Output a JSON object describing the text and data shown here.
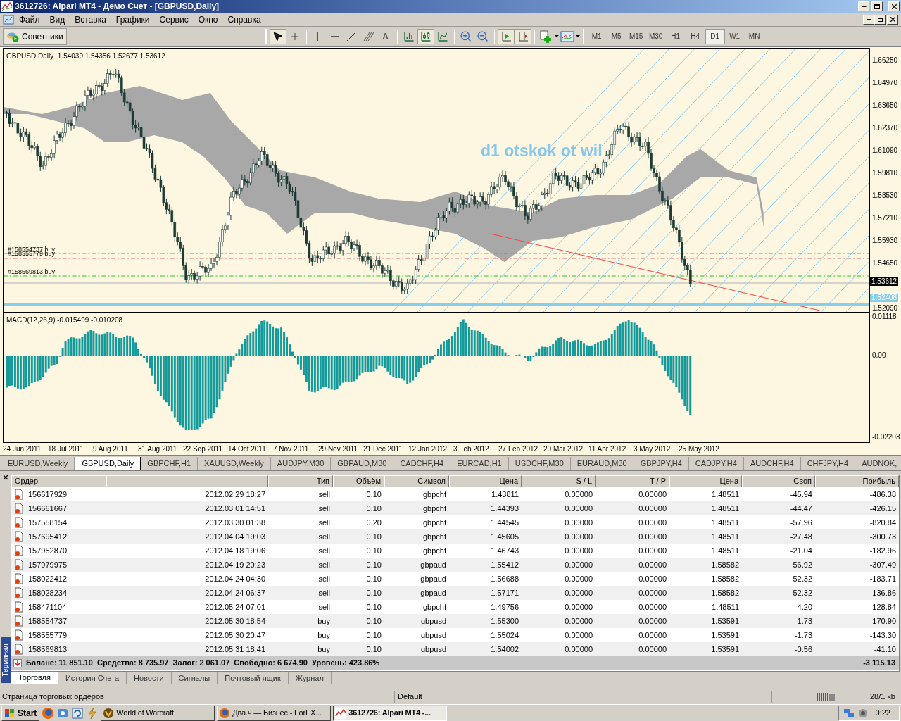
{
  "window": {
    "title": "3612726: Alpari MT4 - Демо Счет - [GBPUSD,Daily]"
  },
  "menu": [
    "Файл",
    "Вид",
    "Вставка",
    "Графики",
    "Сервис",
    "Окно",
    "Справка"
  ],
  "toolbar": {
    "advisors": "Советники",
    "text_tool": "A",
    "timeframes": [
      {
        "label": "M1",
        "selected": false
      },
      {
        "label": "M5",
        "selected": false
      },
      {
        "label": "M15",
        "selected": false
      },
      {
        "label": "M30",
        "selected": false
      },
      {
        "label": "H1",
        "selected": false
      },
      {
        "label": "H4",
        "selected": false
      },
      {
        "label": "D1",
        "selected": true
      },
      {
        "label": "W1",
        "selected": false
      },
      {
        "label": "MN",
        "selected": false
      }
    ]
  },
  "chart": {
    "header": "GBPUSD,Daily  1.54039 1.54356 1.52677 1.53612",
    "note": "d1 otskok ot wil",
    "order_labels": [
      "#158554737 buy",
      "#158555779 buy",
      "#158569813 buy"
    ],
    "price_ticks": [
      "1.66250",
      "1.64970",
      "1.63650",
      "1.62370",
      "1.61090",
      "1.59810",
      "1.58530",
      "1.57210",
      "1.55930",
      "1.54650",
      "1.52090"
    ],
    "current_price": "1.53612",
    "line_price": "1.52408",
    "macd": {
      "header": "MACD(12,26,9) -0.015499 -0.010208",
      "ticks": [
        "0.01118",
        "0.00",
        "-0.02203"
      ]
    },
    "dates": [
      "24 Jun 2011",
      "18 Jul 2011",
      "9 Aug 2011",
      "31 Aug 2011",
      "22 Sep 2011",
      "14 Oct 2011",
      "7 Nov 2011",
      "29 Nov 2011",
      "21 Dec 2011",
      "12 Jan 2012",
      "3 Feb 2012",
      "27 Feb 2012",
      "20 Mar 2012",
      "11 Apr 2012",
      "3 May 2012",
      "25 May 2012"
    ]
  },
  "chart_tabs": [
    {
      "label": "EURUSD,Weekly",
      "selected": false
    },
    {
      "label": "GBPUSD,Daily",
      "selected": true
    },
    {
      "label": "GBPCHF,H1",
      "selected": false
    },
    {
      "label": "XAUUSD,Weekly",
      "selected": false
    },
    {
      "label": "AUDJPY,M30",
      "selected": false
    },
    {
      "label": "GBPAUD,M30",
      "selected": false
    },
    {
      "label": "CADCHF,H4",
      "selected": false
    },
    {
      "label": "EURCAD,H1",
      "selected": false
    },
    {
      "label": "USDCHF,M30",
      "selected": false
    },
    {
      "label": "EURAUD,M30",
      "selected": false
    },
    {
      "label": "GBPJPY,H4",
      "selected": false
    },
    {
      "label": "CADJPY,H4",
      "selected": false
    },
    {
      "label": "AUDCHF,H4",
      "selected": false
    },
    {
      "label": "CHFJPY,H4",
      "selected": false
    },
    {
      "label": "AUDNOK,",
      "selected": false
    }
  ],
  "terminal": {
    "side_label": "Терминал",
    "columns": [
      "Ордер",
      "",
      "Тип",
      "Объём",
      "Символ",
      "Цена",
      "S / L",
      "T / P",
      "Цена",
      "Своп",
      "Прибыль"
    ],
    "rows": [
      [
        "156617929",
        "2012.02.29 18:27",
        "sell",
        "0.10",
        "gbpchf",
        "1.43811",
        "0.00000",
        "0.00000",
        "1.48511",
        "-45.94",
        "-486.38"
      ],
      [
        "156661667",
        "2012.03.01 14:51",
        "sell",
        "0.10",
        "gbpchf",
        "1.44393",
        "0.00000",
        "0.00000",
        "1.48511",
        "-44.47",
        "-426.15"
      ],
      [
        "157558154",
        "2012.03.30 01:38",
        "sell",
        "0.20",
        "gbpchf",
        "1.44545",
        "0.00000",
        "0.00000",
        "1.48511",
        "-57.96",
        "-820.84"
      ],
      [
        "157695412",
        "2012.04.04 19:03",
        "sell",
        "0.10",
        "gbpchf",
        "1.45605",
        "0.00000",
        "0.00000",
        "1.48511",
        "-27.48",
        "-300.73"
      ],
      [
        "157952870",
        "2012.04.18 19:06",
        "sell",
        "0.10",
        "gbpchf",
        "1.46743",
        "0.00000",
        "0.00000",
        "1.48511",
        "-21.04",
        "-182.96"
      ],
      [
        "157979975",
        "2012.04.19 20:23",
        "sell",
        "0.10",
        "gbpaud",
        "1.55412",
        "0.00000",
        "0.00000",
        "1.58582",
        "56.92",
        "-307.49"
      ],
      [
        "158022412",
        "2012.04.24 04:30",
        "sell",
        "0.10",
        "gbpaud",
        "1.56688",
        "0.00000",
        "0.00000",
        "1.58582",
        "52.32",
        "-183.71"
      ],
      [
        "158028234",
        "2012.04.24 06:37",
        "sell",
        "0.10",
        "gbpaud",
        "1.57171",
        "0.00000",
        "0.00000",
        "1.58582",
        "52.32",
        "-136.86"
      ],
      [
        "158471104",
        "2012.05.24 07:01",
        "sell",
        "0.10",
        "gbpchf",
        "1.49756",
        "0.00000",
        "0.00000",
        "1.48511",
        "-4.20",
        "128.84"
      ],
      [
        "158554737",
        "2012.05.30 18:54",
        "buy",
        "0.10",
        "gbpusd",
        "1.55300",
        "0.00000",
        "0.00000",
        "1.53591",
        "-1.73",
        "-170.90"
      ],
      [
        "158555779",
        "2012.05.30 20:47",
        "buy",
        "0.10",
        "gbpusd",
        "1.55024",
        "0.00000",
        "0.00000",
        "1.53591",
        "-1.73",
        "-143.30"
      ],
      [
        "158569813",
        "2012.05.31 18:41",
        "buy",
        "0.10",
        "gbpusd",
        "1.54002",
        "0.00000",
        "0.00000",
        "1.53591",
        "-0.56",
        "-41.10"
      ]
    ],
    "balance": "Баланс: 11 851.10  Средства: 8 735.97  Залог: 2 061.07  Свободно: 6 674.90  Уровень: 423.86%",
    "total": "-3 115.13",
    "tabs": [
      {
        "label": "Торговля",
        "selected": true
      },
      {
        "label": "История Счета",
        "selected": false
      },
      {
        "label": "Новости",
        "selected": false
      },
      {
        "label": "Сигналы",
        "selected": false
      },
      {
        "label": "Почтовый ящик",
        "selected": false
      },
      {
        "label": "Журнал",
        "selected": false
      }
    ]
  },
  "status_bar": {
    "hint": "Страница торговых ордеров",
    "profile": "Default",
    "traffic": "28/1 kb"
  },
  "taskbar": {
    "start": "Start",
    "tasks": [
      {
        "label": "World of Warcraft",
        "selected": false
      },
      {
        "label": "Два.ч — Бизнес - ForEX...",
        "selected": false
      },
      {
        "label": "3612726: Alpari MT4 -...",
        "selected": true
      }
    ],
    "time": "0:22"
  }
}
